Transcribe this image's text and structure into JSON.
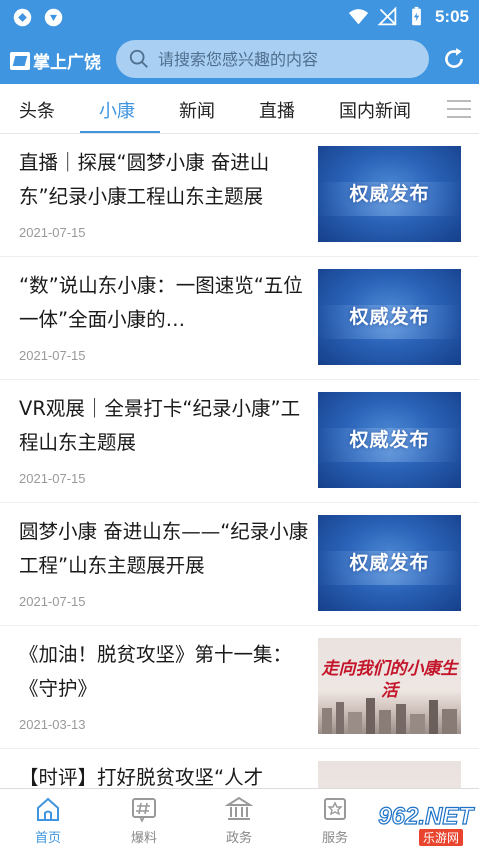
{
  "status_bar": {
    "time": "5:05"
  },
  "header": {
    "logo_text": "掌上广饶",
    "search_placeholder": "请搜索您感兴趣的内容"
  },
  "tabs": [
    {
      "label": "头条"
    },
    {
      "label": "小康",
      "active": true
    },
    {
      "label": "新闻"
    },
    {
      "label": "直播"
    },
    {
      "label": "国内新闻"
    }
  ],
  "news": [
    {
      "title": "直播｜探展“圆梦小康 奋进山东”纪录小康工程山东主题展",
      "date": "2021-07-15",
      "thumb_text": "权威发布"
    },
    {
      "title": "“数”说山东小康：一图速览“五位一体”全面小康的…",
      "date": "2021-07-15",
      "thumb_text": "权威发布"
    },
    {
      "title": "VR观展｜全景打卡“纪录小康”工程山东主题展",
      "date": "2021-07-15",
      "thumb_text": "权威发布"
    },
    {
      "title": "圆梦小康 奋进山东——“纪录小康工程”山东主题展开展",
      "date": "2021-07-15",
      "thumb_text": "权威发布"
    },
    {
      "title": "《加油！脱贫攻坚》第十一集：《守护》",
      "date": "2021-03-13",
      "thumb_text": "走向我们的小康生活"
    },
    {
      "title": "【时评】打好脱贫攻坚“人才",
      "date": "",
      "thumb_text": ""
    }
  ],
  "bottom_nav": [
    {
      "label": "首页",
      "icon": "home-icon",
      "active": true
    },
    {
      "label": "爆料",
      "icon": "hashtag-icon"
    },
    {
      "label": "政务",
      "icon": "government-building-icon"
    },
    {
      "label": "服务",
      "icon": "service-icon"
    }
  ],
  "watermark": {
    "text": "962.NET",
    "sub": "乐游网"
  },
  "colors": {
    "primary": "#3f95e0",
    "search_bg": "#a9cff2",
    "thumb_blue": "#2a63b8",
    "thumb_script": "#c3162b"
  }
}
